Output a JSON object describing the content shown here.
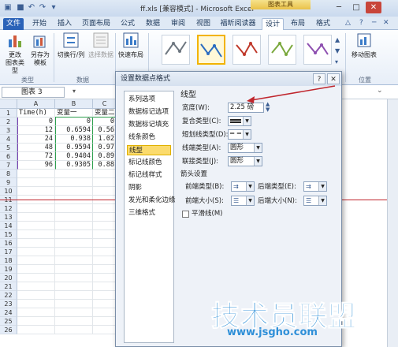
{
  "window": {
    "title": "ff.xls [兼容模式] - Microsoft Excel",
    "context_tab_group": "图表工具"
  },
  "tabs": [
    "文件",
    "开始",
    "插入",
    "页面布局",
    "公式",
    "数据",
    "审阅",
    "视图",
    "福昕阅读器",
    "设计",
    "布局",
    "格式"
  ],
  "ribbon": {
    "change_chart_type": "更改\n图表类型",
    "save_template": "另存为\n模板",
    "switch_row_col": "切换行/列",
    "select_data": "选择数据",
    "quick_layout": "快速布局",
    "move_chart": "移动图表",
    "group_type": "类型",
    "group_data": "数据",
    "group_location": "位置"
  },
  "formula_bar": {
    "name_box": "图表 3"
  },
  "sheet": {
    "columns": [
      "A",
      "B",
      "C"
    ],
    "rows": [
      "1",
      "2",
      "3",
      "4",
      "5",
      "6",
      "7",
      "8",
      "9",
      "10",
      "11",
      "12",
      "13",
      "14",
      "15",
      "16",
      "17",
      "18",
      "19",
      "20",
      "21",
      "22",
      "23",
      "24",
      "25",
      "26"
    ],
    "header_row": [
      "Time(h)",
      "变量一",
      "变量二"
    ],
    "data": [
      [
        "0",
        "0",
        "0"
      ],
      [
        "12",
        "0.6594",
        "0.56"
      ],
      [
        "24",
        "0.938",
        "1.02"
      ],
      [
        "48",
        "0.9594",
        "0.97"
      ],
      [
        "72",
        "0.9404",
        "0.89"
      ],
      [
        "96",
        "0.9305",
        "0.88"
      ]
    ]
  },
  "dialog": {
    "title": "设置数据点格式",
    "nav_items": [
      "系列选项",
      "数据标记选项",
      "数据标记填充",
      "线条颜色",
      "线型",
      "标记线颜色",
      "标记线样式",
      "阴影",
      "发光和柔化边缘",
      "三维格式"
    ],
    "selected_nav": "线型",
    "section_title": "线型",
    "width_label": "宽度(W):",
    "width_value": "2.25 磅",
    "compound_label": "复合类型(C):",
    "dash_label": "短划线类型(D):",
    "cap_label": "线端类型(A):",
    "cap_value": "圆形",
    "join_label": "联接类型(J):",
    "join_value": "圆形",
    "arrow_section": "箭头设置",
    "begin_type_label": "前端类型(B):",
    "end_type_label": "后端类型(E):",
    "begin_size_label": "前端大小(S):",
    "end_size_label": "后端大小(N):",
    "smooth_label": "平滑线(M)"
  },
  "watermark": {
    "brand": "技术员联盟",
    "url": "www.jsgho.com"
  },
  "colors": {
    "accent": "#2a62b8",
    "selection": "#fbdb6d",
    "annotation": "#c0262d"
  }
}
